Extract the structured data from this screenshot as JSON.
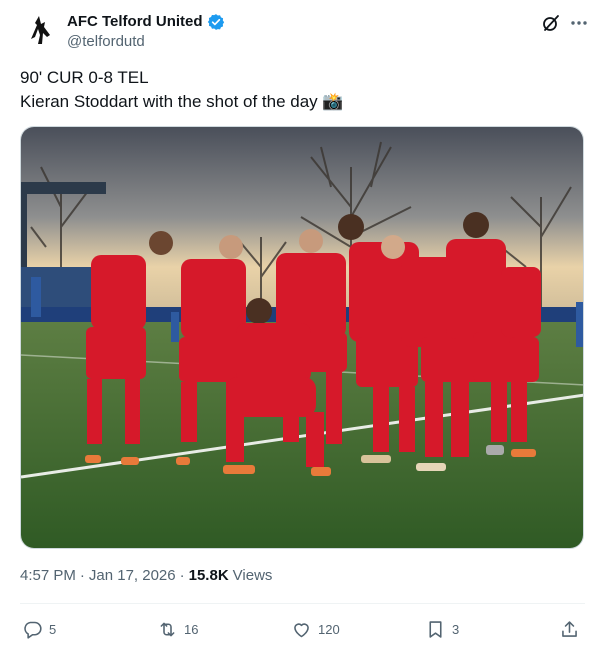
{
  "account": {
    "display_name": "AFC Telford United",
    "handle": "@telfordutd"
  },
  "post": {
    "line1": "90' CUR 0-8 TEL",
    "line2": "Kieran Stoddart with the shot of the day",
    "emoji": "📸"
  },
  "meta": {
    "time": "4:57 PM",
    "separator": "·",
    "date": "Jan 17, 2026",
    "separator2": "·",
    "views_count": "15.8K",
    "views_label": "Views"
  },
  "actions": {
    "replies": "5",
    "reposts": "16",
    "likes": "120",
    "bookmarks": "3"
  },
  "icons": {
    "verified": "verified-badge-icon",
    "grok": "grok-icon",
    "more": "more-icon",
    "reply": "reply-icon",
    "repost": "repost-icon",
    "like": "heart-icon",
    "bookmark": "bookmark-icon",
    "share": "share-icon"
  },
  "colors": {
    "text": "#0f1419",
    "secondary": "#536471",
    "verified": "#1d9bf0",
    "kit_red": "#d6192a",
    "pitch_green": "#3f6b2d"
  }
}
